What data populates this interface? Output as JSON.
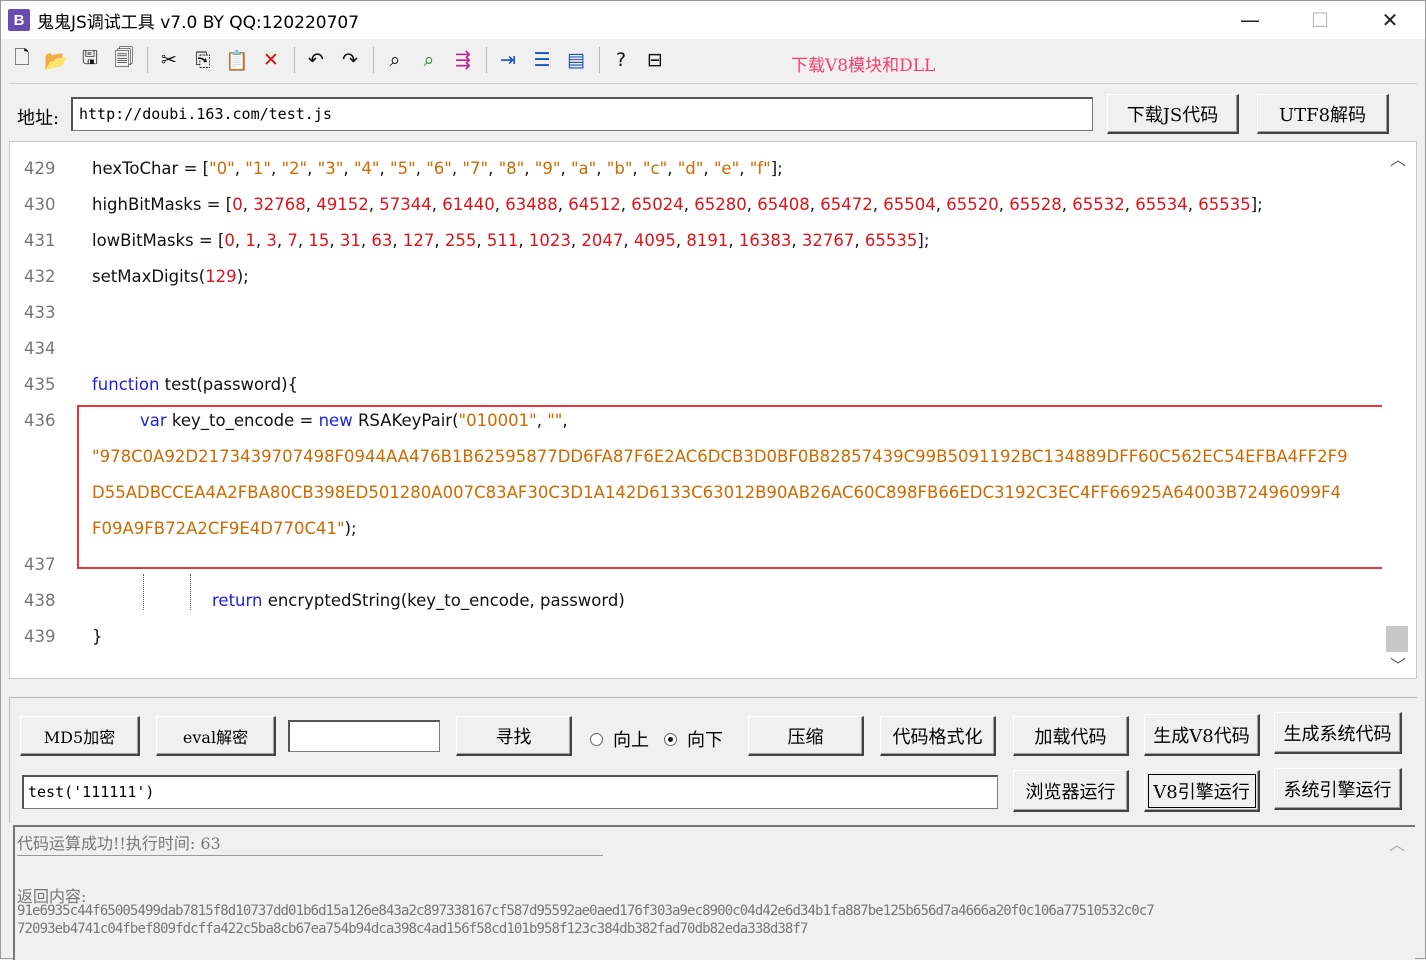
{
  "window": {
    "title": "鬼鬼JS调试工具 v7.0 BY QQ:120220707",
    "app_icon": "B",
    "minimize": "—",
    "maximize": "☐",
    "close": "✕"
  },
  "toolbar": {
    "icons": [
      "new-file-icon",
      "open-folder-icon",
      "save-icon",
      "save-all-icon",
      "cut-icon",
      "copy-icon",
      "paste-icon",
      "delete-icon",
      "undo-icon",
      "redo-icon",
      "find-icon",
      "find-replace-icon",
      "align-icon",
      "indent-icon",
      "numbered-list-icon",
      "window-icon",
      "help-icon",
      "bookmark-icon"
    ],
    "download_link": "下载V8模块和DLL"
  },
  "address": {
    "label": "地址:",
    "value": "http://doubi.163.com/test.js",
    "download_button": "下载JS代码",
    "utf8_button": "UTF8解码"
  },
  "editor": {
    "lines": [
      {
        "no": "429",
        "tokens": [
          [
            "plain",
            "hexToChar = ["
          ],
          [
            "str",
            "\"0\""
          ],
          [
            "plain",
            ", "
          ],
          [
            "str",
            "\"1\""
          ],
          [
            "plain",
            ", "
          ],
          [
            "str",
            "\"2\""
          ],
          [
            "plain",
            ", "
          ],
          [
            "str",
            "\"3\""
          ],
          [
            "plain",
            ", "
          ],
          [
            "str",
            "\"4\""
          ],
          [
            "plain",
            ", "
          ],
          [
            "str",
            "\"5\""
          ],
          [
            "plain",
            ", "
          ],
          [
            "str",
            "\"6\""
          ],
          [
            "plain",
            ", "
          ],
          [
            "str",
            "\"7\""
          ],
          [
            "plain",
            ", "
          ],
          [
            "str",
            "\"8\""
          ],
          [
            "plain",
            ", "
          ],
          [
            "str",
            "\"9\""
          ],
          [
            "plain",
            ", "
          ],
          [
            "str",
            "\"a\""
          ],
          [
            "plain",
            ", "
          ],
          [
            "str",
            "\"b\""
          ],
          [
            "plain",
            ", "
          ],
          [
            "str",
            "\"c\""
          ],
          [
            "plain",
            ", "
          ],
          [
            "str",
            "\"d\""
          ],
          [
            "plain",
            ", "
          ],
          [
            "str",
            "\"e\""
          ],
          [
            "plain",
            ", "
          ],
          [
            "str",
            "\"f\""
          ],
          [
            "plain",
            "];"
          ]
        ]
      },
      {
        "no": "430",
        "tokens": [
          [
            "plain",
            "highBitMasks = ["
          ],
          [
            "num",
            "0"
          ],
          [
            "plain",
            ", "
          ],
          [
            "num",
            "32768"
          ],
          [
            "plain",
            ", "
          ],
          [
            "num",
            "49152"
          ],
          [
            "plain",
            ", "
          ],
          [
            "num",
            "57344"
          ],
          [
            "plain",
            ", "
          ],
          [
            "num",
            "61440"
          ],
          [
            "plain",
            ", "
          ],
          [
            "num",
            "63488"
          ],
          [
            "plain",
            ", "
          ],
          [
            "num",
            "64512"
          ],
          [
            "plain",
            ", "
          ],
          [
            "num",
            "65024"
          ],
          [
            "plain",
            ", "
          ],
          [
            "num",
            "65280"
          ],
          [
            "plain",
            ", "
          ],
          [
            "num",
            "65408"
          ],
          [
            "plain",
            ", "
          ],
          [
            "num",
            "65472"
          ],
          [
            "plain",
            ", "
          ],
          [
            "num",
            "65504"
          ],
          [
            "plain",
            ", "
          ],
          [
            "num",
            "65520"
          ],
          [
            "plain",
            ", "
          ],
          [
            "num",
            "65528"
          ],
          [
            "plain",
            ", "
          ],
          [
            "num",
            "65532"
          ],
          [
            "plain",
            ", "
          ],
          [
            "num",
            "65534"
          ],
          [
            "plain",
            ", "
          ],
          [
            "num",
            "65535"
          ],
          [
            "plain",
            "];"
          ]
        ]
      },
      {
        "no": "431",
        "tokens": [
          [
            "plain",
            "lowBitMasks = ["
          ],
          [
            "num",
            "0"
          ],
          [
            "plain",
            ", "
          ],
          [
            "num",
            "1"
          ],
          [
            "plain",
            ", "
          ],
          [
            "num",
            "3"
          ],
          [
            "plain",
            ", "
          ],
          [
            "num",
            "7"
          ],
          [
            "plain",
            ", "
          ],
          [
            "num",
            "15"
          ],
          [
            "plain",
            ", "
          ],
          [
            "num",
            "31"
          ],
          [
            "plain",
            ", "
          ],
          [
            "num",
            "63"
          ],
          [
            "plain",
            ", "
          ],
          [
            "num",
            "127"
          ],
          [
            "plain",
            ", "
          ],
          [
            "num",
            "255"
          ],
          [
            "plain",
            ", "
          ],
          [
            "num",
            "511"
          ],
          [
            "plain",
            ", "
          ],
          [
            "num",
            "1023"
          ],
          [
            "plain",
            ", "
          ],
          [
            "num",
            "2047"
          ],
          [
            "plain",
            ", "
          ],
          [
            "num",
            "4095"
          ],
          [
            "plain",
            ", "
          ],
          [
            "num",
            "8191"
          ],
          [
            "plain",
            ", "
          ],
          [
            "num",
            "16383"
          ],
          [
            "plain",
            ", "
          ],
          [
            "num",
            "32767"
          ],
          [
            "plain",
            ", "
          ],
          [
            "num",
            "65535"
          ],
          [
            "plain",
            "];"
          ]
        ]
      },
      {
        "no": "432",
        "tokens": [
          [
            "plain",
            "setMaxDigits("
          ],
          [
            "num",
            "129"
          ],
          [
            "plain",
            ");"
          ]
        ]
      },
      {
        "no": "433",
        "tokens": []
      },
      {
        "no": "434",
        "tokens": []
      },
      {
        "no": "435",
        "tokens": [
          [
            "kw",
            "function"
          ],
          [
            "plain",
            " test(password){"
          ]
        ]
      },
      {
        "no": "436",
        "indent": 48,
        "tokens": [
          [
            "kw",
            "var"
          ],
          [
            "plain",
            " key_to_encode = "
          ],
          [
            "kw",
            "new"
          ],
          [
            "plain",
            " RSAKeyPair("
          ],
          [
            "str",
            "\"010001\""
          ],
          [
            "plain",
            ", "
          ],
          [
            "str",
            "\"\""
          ],
          [
            "plain",
            ","
          ]
        ]
      },
      {
        "no": "",
        "tokens": [
          [
            "str",
            "\"978C0A92D2173439707498F0944AA476B1B62595877DD6FA87F6E2AC6DCB3D0BF0B82857439C99B5091192BC134889DFF60C562EC54EFBA4FF2F9"
          ]
        ]
      },
      {
        "no": "",
        "tokens": [
          [
            "str",
            "D55ADBCCEA4A2FBA80CB398ED501280A007C83AF30C3D1A142D6133C63012B90AB26AC60C898FB66EDC3192C3EC4FF66925A64003B72496099F4"
          ]
        ]
      },
      {
        "no": "",
        "tokens": [
          [
            "str",
            "F09A9FB72A2CF9E4D770C41\""
          ],
          [
            "plain",
            ");"
          ]
        ]
      },
      {
        "no": "437",
        "tokens": []
      },
      {
        "no": "438",
        "indent": 120,
        "tokens": [
          [
            "kw",
            "return"
          ],
          [
            "plain",
            " encryptedString(key_to_encode, password)"
          ]
        ]
      },
      {
        "no": "439",
        "tokens": [
          [
            "plain",
            "}"
          ]
        ]
      }
    ]
  },
  "panel": {
    "md5_button": "MD5加密",
    "eval_button": "eval解密",
    "search_value": "",
    "find_button": "寻找",
    "radio_up": "向上",
    "radio_down": "向下",
    "radio_selected": "down",
    "compress_button": "压缩",
    "format_button": "代码格式化",
    "load_button": "加载代码",
    "gen_v8_button": "生成V8代码",
    "gen_sys_button": "生成系统代码",
    "command_value": "test('111111')",
    "browser_run_button": "浏览器运行",
    "v8_run_button": "V8引擎运行",
    "sys_run_button": "系统引擎运行"
  },
  "output": {
    "status": "代码运算成功!!执行时间: 63",
    "label": "返回内容:",
    "line1": "91e6935c44f65005499dab7815f8d10737dd01b6d15a126e843a2c897338167cf587d95592ae0aed176f303a9ec8900c04d42e6d34b1fa887be125b656d7a4666a20f0c106a77510532c0c7",
    "line2": "72093eb4741c04fbef809fdcffa422c5ba8cb67ea754b94dca398c4ad156f58cd101b958f123c384db382fad70db82eda338d38f7"
  },
  "colors": {
    "keyword": "#1e1ee6",
    "string": "#d06a00",
    "number": "#e0131a",
    "highlight_box": "#e8353b",
    "download_link": "#ff3b6e"
  }
}
